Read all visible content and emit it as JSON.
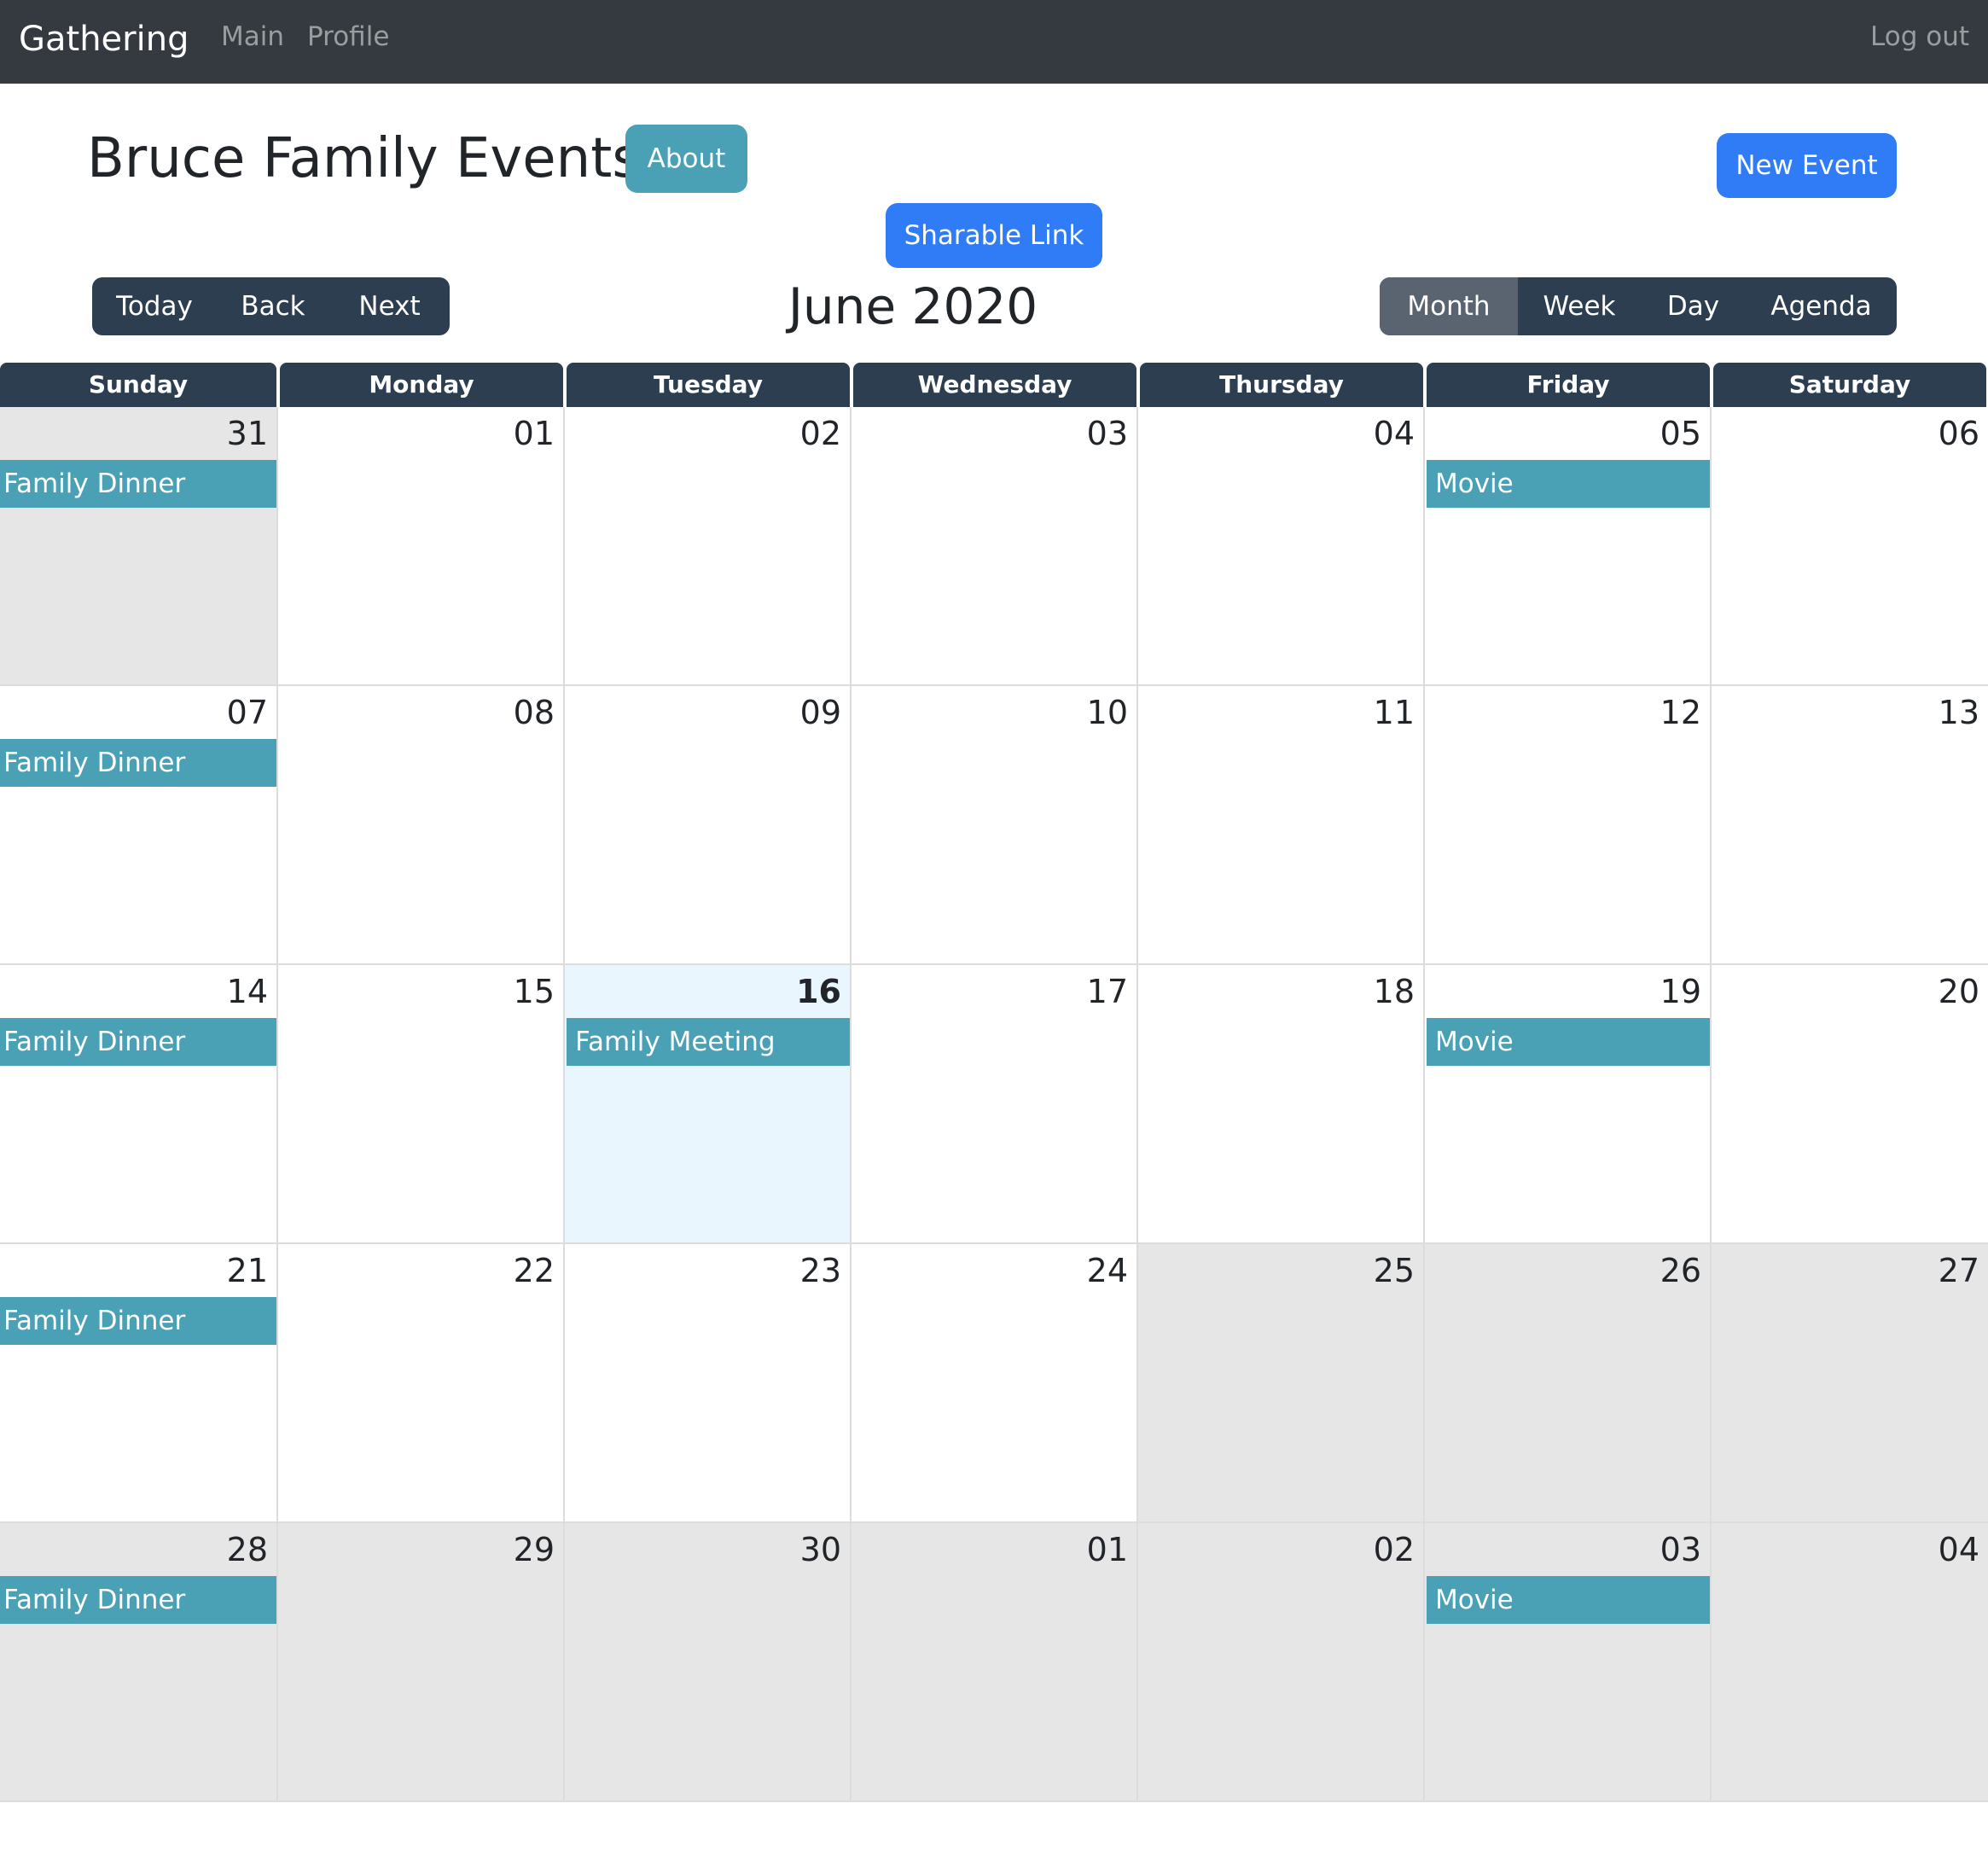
{
  "navbar": {
    "brand": "Gathering",
    "links": [
      "Main",
      "Profile"
    ],
    "logout": "Log out"
  },
  "header": {
    "title": "Bruce Family Events",
    "about_label": "About",
    "new_event_label": "New Event",
    "share_label": "Sharable Link"
  },
  "toolbar": {
    "nav_buttons": [
      "Today",
      "Back",
      "Next"
    ],
    "label": "June 2020",
    "views": [
      "Month",
      "Week",
      "Day",
      "Agenda"
    ],
    "active_view": "Month"
  },
  "calendar": {
    "weekdays": [
      "Sunday",
      "Monday",
      "Tuesday",
      "Wednesday",
      "Thursday",
      "Friday",
      "Saturday"
    ],
    "weeks": [
      [
        {
          "day": "31",
          "state": "off",
          "events": [
            "Family Dinner"
          ]
        },
        {
          "day": "01",
          "state": "",
          "events": []
        },
        {
          "day": "02",
          "state": "",
          "events": []
        },
        {
          "day": "03",
          "state": "",
          "events": []
        },
        {
          "day": "04",
          "state": "",
          "events": []
        },
        {
          "day": "05",
          "state": "",
          "events": [
            "Movie"
          ]
        },
        {
          "day": "06",
          "state": "",
          "events": []
        }
      ],
      [
        {
          "day": "07",
          "state": "",
          "events": [
            "Family Dinner"
          ]
        },
        {
          "day": "08",
          "state": "",
          "events": []
        },
        {
          "day": "09",
          "state": "",
          "events": []
        },
        {
          "day": "10",
          "state": "",
          "events": []
        },
        {
          "day": "11",
          "state": "",
          "events": []
        },
        {
          "day": "12",
          "state": "",
          "events": []
        },
        {
          "day": "13",
          "state": "",
          "events": []
        }
      ],
      [
        {
          "day": "14",
          "state": "",
          "events": [
            "Family Dinner"
          ]
        },
        {
          "day": "15",
          "state": "",
          "events": []
        },
        {
          "day": "16",
          "state": "today",
          "events": [
            "Family Meeting"
          ]
        },
        {
          "day": "17",
          "state": "",
          "events": []
        },
        {
          "day": "18",
          "state": "",
          "events": []
        },
        {
          "day": "19",
          "state": "",
          "events": [
            "Movie"
          ]
        },
        {
          "day": "20",
          "state": "",
          "events": []
        }
      ],
      [
        {
          "day": "21",
          "state": "",
          "events": [
            "Family Dinner"
          ]
        },
        {
          "day": "22",
          "state": "",
          "events": []
        },
        {
          "day": "23",
          "state": "",
          "events": []
        },
        {
          "day": "24",
          "state": "",
          "events": []
        },
        {
          "day": "25",
          "state": "off",
          "events": []
        },
        {
          "day": "26",
          "state": "off",
          "events": []
        },
        {
          "day": "27",
          "state": "off",
          "events": []
        }
      ],
      [
        {
          "day": "28",
          "state": "off",
          "events": [
            "Family Dinner"
          ]
        },
        {
          "day": "29",
          "state": "off",
          "events": []
        },
        {
          "day": "30",
          "state": "off",
          "events": []
        },
        {
          "day": "01",
          "state": "off",
          "events": []
        },
        {
          "day": "02",
          "state": "off",
          "events": []
        },
        {
          "day": "03",
          "state": "off",
          "events": [
            "Movie"
          ]
        },
        {
          "day": "04",
          "state": "off",
          "events": []
        }
      ]
    ]
  },
  "colors": {
    "navbar_bg": "#343a40",
    "toolbar_bg": "#2c3e50",
    "event_bg": "#4aa0b5",
    "primary_button": "#2f7cf6",
    "info_button": "#4aa0b5",
    "off_range_day": "#e6e6e6",
    "today_bg": "#eaf6fd"
  }
}
